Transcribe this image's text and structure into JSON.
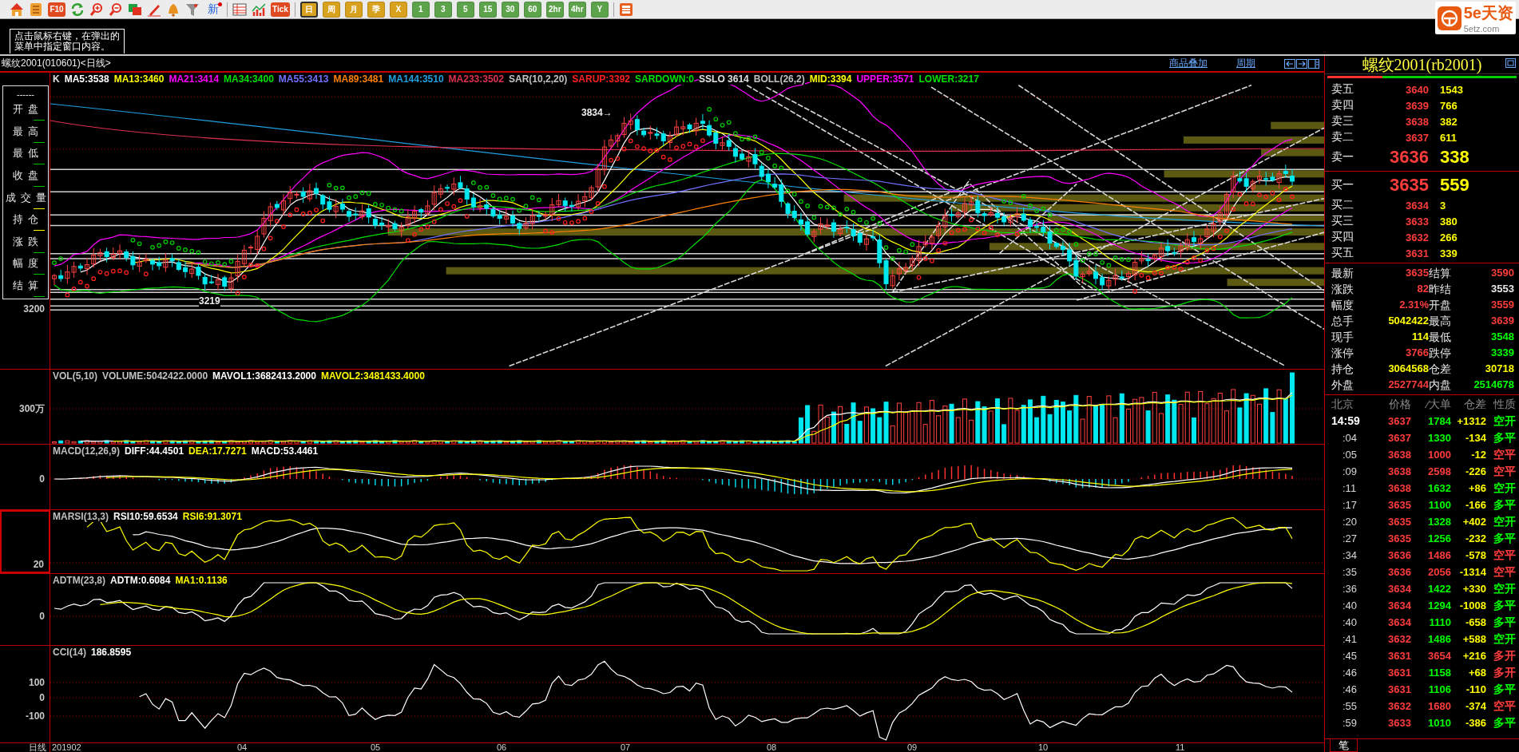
{
  "toolbar": {
    "text_buttons": [
      "F10",
      "新",
      "Tick"
    ],
    "periods": [
      {
        "label": "日",
        "selected": true,
        "color": "#d9a21e"
      },
      {
        "label": "周",
        "selected": false,
        "color": "#d9a21e"
      },
      {
        "label": "月",
        "selected": false,
        "color": "#d9a21e"
      },
      {
        "label": "季",
        "selected": false,
        "color": "#d9a21e"
      },
      {
        "label": "X",
        "selected": false,
        "color": "#d9a21e"
      },
      {
        "label": "1",
        "selected": false,
        "color": "#5da34c"
      },
      {
        "label": "3",
        "selected": false,
        "color": "#5da34c"
      },
      {
        "label": "5",
        "selected": false,
        "color": "#5da34c"
      },
      {
        "label": "15",
        "selected": false,
        "color": "#5da34c"
      },
      {
        "label": "30",
        "selected": false,
        "color": "#5da34c"
      },
      {
        "label": "60",
        "selected": false,
        "color": "#5da34c"
      },
      {
        "label": "2hr",
        "selected": false,
        "color": "#5da34c"
      },
      {
        "label": "4hr",
        "selected": false,
        "color": "#5da34c"
      },
      {
        "label": "Y",
        "selected": false,
        "color": "#5da34c"
      }
    ]
  },
  "hint": {
    "lines": [
      "点击鼠标右键，在弹出的",
      "菜单中指定窗口内容。"
    ]
  },
  "logo": {
    "name": "5e天资",
    "site": "5etz.com"
  },
  "chart_header": {
    "title": "螺纹2001(010601)<日线>",
    "links": [
      "商品叠加",
      "周期"
    ]
  },
  "main_chart": {
    "legend": [
      {
        "text": "K",
        "color": "#e0e0e0"
      },
      {
        "text": "MA5:3538",
        "color": "#ffffff"
      },
      {
        "text": "MA13:3460",
        "color": "#ffff00"
      },
      {
        "text": "MA21:3414",
        "color": "#ff00ff"
      },
      {
        "text": "MA34:3400",
        "color": "#00e000"
      },
      {
        "text": "MA55:3413",
        "color": "#7070ff"
      },
      {
        "text": "MA89:3481",
        "color": "#ff8000"
      },
      {
        "text": "MA144:3510",
        "color": "#20a0e0"
      },
      {
        "text": "MA233:3502",
        "color": "#e03050"
      },
      {
        "text": "SAR(10,2,20)",
        "color": "#c0c0c0"
      },
      {
        "text": "SARUP:3392",
        "color": "#ff2020"
      },
      {
        "text": "SARDOWN:0",
        "color": "#00e000"
      },
      {
        "text": "SSLO 3614",
        "color": "#e0e0e0"
      },
      {
        "text": "BOLL(26,2)",
        "color": "#c0c0c0"
      },
      {
        "text": "MID:3394",
        "color": "#ffff00"
      },
      {
        "text": "UPPER:3571",
        "color": "#ff00ff"
      },
      {
        "text": "LOWER:3217",
        "color": "#00e000"
      }
    ],
    "axis_labels": [
      "3200"
    ],
    "high_label": "3834→",
    "low_label": "3219",
    "info_box": {
      "date": "------",
      "labels": [
        "开盘",
        "最高",
        "最低",
        "收盘",
        "成交量",
        "持仓",
        "涨跌",
        "幅度",
        "结算"
      ]
    }
  },
  "indicators": [
    {
      "kind": "volume",
      "selected": false,
      "axis_labels": [
        "300万"
      ],
      "legend": [
        {
          "text": "VOL(5,10)",
          "color": "#c0c0c0"
        },
        {
          "text": "VOLUME:5042422.0000",
          "color": "#c0c0c0"
        },
        {
          "text": "MAVOL1:3682413.2000",
          "color": "#ffffff"
        },
        {
          "text": "MAVOL2:3481433.4000",
          "color": "#ffff00"
        }
      ]
    },
    {
      "kind": "macd",
      "selected": false,
      "axis_labels": [
        "0"
      ],
      "legend": [
        {
          "text": "MACD(12,26,9)",
          "color": "#c0c0c0"
        },
        {
          "text": "DIFF:44.4501",
          "color": "#ffffff"
        },
        {
          "text": "DEA:17.7271",
          "color": "#ffff00"
        },
        {
          "text": "MACD:53.4461",
          "color": "#ffffff"
        }
      ]
    },
    {
      "kind": "rsi",
      "selected": true,
      "axis_labels": [
        "20"
      ],
      "legend": [
        {
          "text": "MARSI(13,3)",
          "color": "#c0c0c0"
        },
        {
          "text": "RSI10:59.6534",
          "color": "#ffffff"
        },
        {
          "text": "RSI6:91.3071",
          "color": "#ffff00"
        }
      ]
    },
    {
      "kind": "adtm",
      "selected": false,
      "axis_labels": [
        "0"
      ],
      "legend": [
        {
          "text": "ADTM(23,8)",
          "color": "#c0c0c0"
        },
        {
          "text": "ADTM:0.6084",
          "color": "#ffffff"
        },
        {
          "text": "MA1:0.1136",
          "color": "#ffff00"
        }
      ]
    },
    {
      "kind": "cci",
      "selected": false,
      "axis_labels": [
        "100",
        "0",
        "-100"
      ],
      "legend": [
        {
          "text": "CCI(14)",
          "color": "#c0c0c0"
        },
        {
          "text": "186.8595",
          "color": "#ffffff"
        }
      ]
    }
  ],
  "x_axis": {
    "period": "日线",
    "ticks": [
      "201902",
      "04",
      "05",
      "06",
      "07",
      "08",
      "09",
      "10",
      "11"
    ]
  },
  "quote": {
    "title": "螺纹2001(rb2001)",
    "ratio_bar": {
      "level": 0.29
    },
    "asks": [
      {
        "label": "卖五",
        "price": "3640",
        "volume": "1543"
      },
      {
        "label": "卖四",
        "price": "3639",
        "volume": "766"
      },
      {
        "label": "卖三",
        "price": "3638",
        "volume": "382"
      },
      {
        "label": "卖二",
        "price": "3637",
        "volume": "611"
      },
      {
        "label": "卖一",
        "price": "3636",
        "volume": "338"
      }
    ],
    "bids": [
      {
        "label": "买一",
        "price": "3635",
        "volume": "559"
      },
      {
        "label": "买二",
        "price": "3634",
        "volume": "3"
      },
      {
        "label": "买三",
        "price": "3633",
        "volume": "380"
      },
      {
        "label": "买四",
        "price": "3632",
        "volume": "266"
      },
      {
        "label": "买五",
        "price": "3631",
        "volume": "339"
      }
    ],
    "stats": [
      {
        "label": "最新",
        "value": "3635",
        "color": "#ff3c3c"
      },
      {
        "label": "结算",
        "value": "3590",
        "color": "#ff3c3c"
      },
      {
        "label": "涨跌",
        "value": "82",
        "color": "#ff3c3c"
      },
      {
        "label": "昨结",
        "value": "3553",
        "color": "#e8e8e8"
      },
      {
        "label": "幅度",
        "value": "2.31%",
        "color": "#ff3c3c"
      },
      {
        "label": "开盘",
        "value": "3559",
        "color": "#ff3c3c"
      },
      {
        "label": "总手",
        "value": "5042422",
        "color": "#ffff00"
      },
      {
        "label": "最高",
        "value": "3639",
        "color": "#ff3c3c"
      },
      {
        "label": "现手",
        "value": "114",
        "color": "#ffff00"
      },
      {
        "label": "最低",
        "value": "3548",
        "color": "#00ff00"
      },
      {
        "label": "涨停",
        "value": "3766",
        "color": "#ff3c3c"
      },
      {
        "label": "跌停",
        "value": "3339",
        "color": "#00ff00"
      },
      {
        "label": "持仓",
        "value": "3064568",
        "color": "#ffff00"
      },
      {
        "label": "仓差",
        "value": "30718",
        "color": "#ffff00"
      },
      {
        "label": "外盘",
        "value": "2527744",
        "color": "#ff3c3c"
      },
      {
        "label": "内盘",
        "value": "2514678",
        "color": "#00ff00"
      }
    ],
    "ticks_header": [
      "北京",
      "价格",
      "∕大单",
      "仓差",
      "性质"
    ],
    "ticks": [
      {
        "time": "14:59",
        "price": "3637",
        "volume": {
          "text": "1784",
          "color": "#00ff00"
        },
        "change": "+1312",
        "nature": {
          "text": "空开",
          "color": "#00ff00"
        }
      },
      {
        "time": ":04",
        "price": "3637",
        "volume": {
          "text": "1330",
          "color": "#00ff00"
        },
        "change": "-134",
        "nature": {
          "text": "多平",
          "color": "#00ff00"
        }
      },
      {
        "time": ":05",
        "price": "3638",
        "volume": {
          "text": "1000",
          "color": "#ff3c3c"
        },
        "change": "-12",
        "nature": {
          "text": "空平",
          "color": "#ff3c3c"
        }
      },
      {
        "time": ":09",
        "price": "3638",
        "volume": {
          "text": "2598",
          "color": "#ff3c3c"
        },
        "change": "-226",
        "nature": {
          "text": "空平",
          "color": "#ff3c3c"
        }
      },
      {
        "time": ":11",
        "price": "3638",
        "volume": {
          "text": "1632",
          "color": "#00ff00"
        },
        "change": "+86",
        "nature": {
          "text": "空开",
          "color": "#00ff00"
        }
      },
      {
        "time": ":17",
        "price": "3635",
        "volume": {
          "text": "1100",
          "color": "#00ff00"
        },
        "change": "-166",
        "nature": {
          "text": "多平",
          "color": "#00ff00"
        }
      },
      {
        "time": ":20",
        "price": "3635",
        "volume": {
          "text": "1328",
          "color": "#00ff00"
        },
        "change": "+402",
        "nature": {
          "text": "空开",
          "color": "#00ff00"
        }
      },
      {
        "time": ":27",
        "price": "3635",
        "volume": {
          "text": "1256",
          "color": "#00ff00"
        },
        "change": "-232",
        "nature": {
          "text": "多平",
          "color": "#00ff00"
        }
      },
      {
        "time": ":34",
        "price": "3636",
        "volume": {
          "text": "1486",
          "color": "#ff3c3c"
        },
        "change": "-578",
        "nature": {
          "text": "空平",
          "color": "#ff3c3c"
        }
      },
      {
        "time": ":35",
        "price": "3636",
        "volume": {
          "text": "2056",
          "color": "#ff3c3c"
        },
        "change": "-1314",
        "nature": {
          "text": "空平",
          "color": "#ff3c3c"
        }
      },
      {
        "time": ":36",
        "price": "3634",
        "volume": {
          "text": "1422",
          "color": "#00ff00"
        },
        "change": "+330",
        "nature": {
          "text": "空开",
          "color": "#00ff00"
        }
      },
      {
        "time": ":40",
        "price": "3634",
        "volume": {
          "text": "1294",
          "color": "#00ff00"
        },
        "change": "-1008",
        "nature": {
          "text": "多平",
          "color": "#00ff00"
        }
      },
      {
        "time": ":40",
        "price": "3634",
        "volume": {
          "text": "1110",
          "color": "#00ff00"
        },
        "change": "-658",
        "nature": {
          "text": "多平",
          "color": "#00ff00"
        }
      },
      {
        "time": ":41",
        "price": "3632",
        "volume": {
          "text": "1486",
          "color": "#00ff00"
        },
        "change": "+588",
        "nature": {
          "text": "空开",
          "color": "#00ff00"
        }
      },
      {
        "time": ":45",
        "price": "3631",
        "volume": {
          "text": "3654",
          "color": "#ff3c3c"
        },
        "change": "+216",
        "nature": {
          "text": "多开",
          "color": "#ff3c3c"
        }
      },
      {
        "time": ":46",
        "price": "3631",
        "volume": {
          "text": "1158",
          "color": "#00ff00"
        },
        "change": "+68",
        "nature": {
          "text": "多开",
          "color": "#ff3c3c"
        }
      },
      {
        "time": ":46",
        "price": "3631",
        "volume": {
          "text": "1106",
          "color": "#00ff00"
        },
        "change": "-110",
        "nature": {
          "text": "多平",
          "color": "#00ff00"
        }
      },
      {
        "time": ":55",
        "price": "3632",
        "volume": {
          "text": "1680",
          "color": "#ff3c3c"
        },
        "change": "-374",
        "nature": {
          "text": "空平",
          "color": "#ff3c3c"
        }
      },
      {
        "time": ":59",
        "price": "3633",
        "volume": {
          "text": "1010",
          "color": "#00ff00"
        },
        "change": "-386",
        "nature": {
          "text": "多平",
          "color": "#00ff00"
        }
      }
    ],
    "tab": "笔"
  }
}
